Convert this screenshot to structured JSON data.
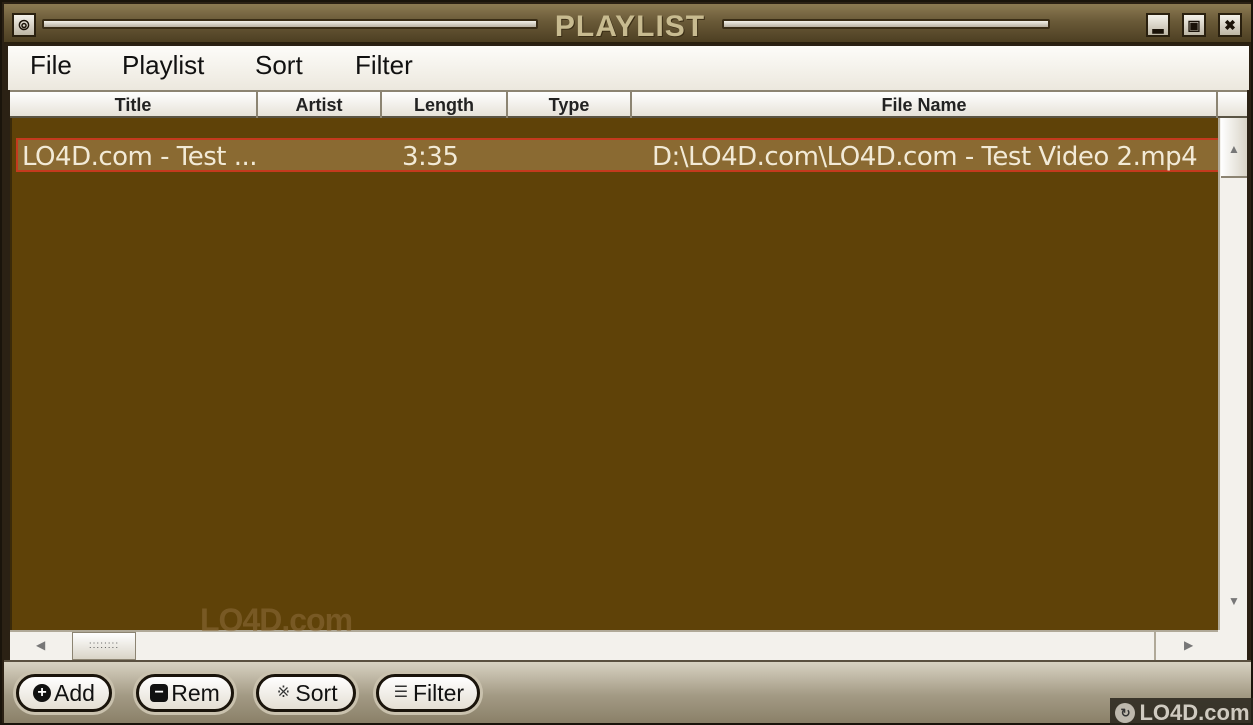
{
  "window": {
    "title": "PLAYLIST",
    "system_buttons": {
      "menu": "⦾",
      "minimize": "▂",
      "maximize": "▣",
      "close": "✖"
    }
  },
  "menubar": {
    "items": [
      "File",
      "Playlist",
      "Sort",
      "Filter"
    ]
  },
  "columns": [
    "Title",
    "Artist",
    "Length",
    "Type",
    "File Name"
  ],
  "rows": [
    {
      "title": "LO4D.com - Test ...",
      "artist": "",
      "length": "3:35",
      "type": "",
      "file_name": "D:\\LO4D.com\\LO4D.com - Test Video 2.mp4",
      "selected": true
    }
  ],
  "scrollbars": {
    "up_arrow": "▲",
    "down_arrow": "▼",
    "left_arrow": "◀",
    "right_arrow": "▶",
    "grip": "::::::::"
  },
  "bottom_buttons": [
    {
      "label": "Add",
      "icon": "plus-icon",
      "glyph": "+"
    },
    {
      "label": "Rem",
      "icon": "minus-icon",
      "glyph": "−"
    },
    {
      "label": "Sort",
      "icon": "sort-icon",
      "glyph": "※"
    },
    {
      "label": "Filter",
      "icon": "filter-icon",
      "glyph": "☰"
    }
  ],
  "watermark": {
    "text": "LO4D.com",
    "logo_glyph": "↻"
  },
  "colors": {
    "list_background": "#5f4208",
    "selected_row": "#8a6a32",
    "selected_border": "#c43a1e",
    "row_text": "#f2ead6"
  }
}
